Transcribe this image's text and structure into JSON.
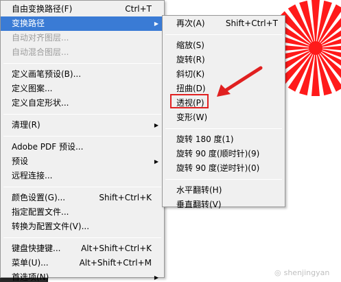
{
  "main_menu": {
    "items": [
      {
        "label": "自由变换路径(F)",
        "shortcut": "Ctrl+T"
      },
      {
        "label": "变换路径",
        "shortcut": ""
      },
      {
        "label": "自动对齐图层...",
        "shortcut": ""
      },
      {
        "label": "自动混合图层...",
        "shortcut": ""
      },
      {
        "label": "定义画笔预设(B)...",
        "shortcut": ""
      },
      {
        "label": "定义图案...",
        "shortcut": ""
      },
      {
        "label": "定义自定形状...",
        "shortcut": ""
      },
      {
        "label": "清理(R)",
        "shortcut": ""
      },
      {
        "label": "Adobe PDF 预设...",
        "shortcut": ""
      },
      {
        "label": "预设",
        "shortcut": ""
      },
      {
        "label": "远程连接...",
        "shortcut": ""
      },
      {
        "label": "颜色设置(G)...",
        "shortcut": "Shift+Ctrl+K"
      },
      {
        "label": "指定配置文件...",
        "shortcut": ""
      },
      {
        "label": "转换为配置文件(V)...",
        "shortcut": ""
      },
      {
        "label": "键盘快捷键...",
        "shortcut": "Alt+Shift+Ctrl+K"
      },
      {
        "label": "菜单(U)...",
        "shortcut": "Alt+Shift+Ctrl+M"
      },
      {
        "label": "首选项(N)",
        "shortcut": ""
      }
    ]
  },
  "sub_menu": {
    "items": [
      {
        "label": "再次(A)",
        "shortcut": "Shift+Ctrl+T"
      },
      {
        "label": "缩放(S)",
        "shortcut": ""
      },
      {
        "label": "旋转(R)",
        "shortcut": ""
      },
      {
        "label": "斜切(K)",
        "shortcut": ""
      },
      {
        "label": "扭曲(D)",
        "shortcut": ""
      },
      {
        "label": "透视(P)",
        "shortcut": ""
      },
      {
        "label": "变形(W)",
        "shortcut": ""
      },
      {
        "label": "旋转 180 度(1)",
        "shortcut": ""
      },
      {
        "label": "旋转 90 度(顺时针)(9)",
        "shortcut": ""
      },
      {
        "label": "旋转 90 度(逆时针)(0)",
        "shortcut": ""
      },
      {
        "label": "水平翻转(H)",
        "shortcut": ""
      },
      {
        "label": "垂直翻转(V)",
        "shortcut": ""
      }
    ]
  },
  "watermark": {
    "text": "shenjingyan"
  },
  "colors": {
    "highlight": "#3a7bd5",
    "annotation": "#e02020",
    "flower": "#ff1a1a"
  },
  "icons": {
    "submenu_arrow": "triangle-right-icon",
    "annotation_arrow": "red-arrow-icon"
  }
}
